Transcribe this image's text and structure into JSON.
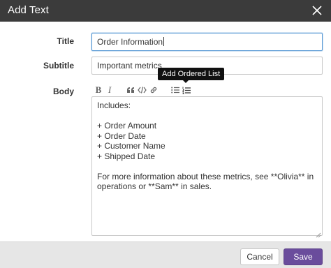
{
  "dialog": {
    "title": "Add Text"
  },
  "form": {
    "title_label": "Title",
    "title_value": "Order Information",
    "subtitle_label": "Subtitle",
    "subtitle_value": "Important metrics",
    "body_label": "Body",
    "body_value": "Includes:\n\n+ Order Amount\n+ Order Date\n+ Customer Name\n+ Shipped Date\n\nFor more information about these metrics, see **Olivia** in operations or **Sam** in sales."
  },
  "toolbar": {
    "tools": [
      "bold-icon",
      "italic-icon",
      "quote-icon",
      "code-icon",
      "link-icon",
      "unordered-list-icon",
      "ordered-list-icon"
    ],
    "bold_glyph": "B",
    "italic_glyph": "I",
    "tooltip": "Add Ordered List"
  },
  "footer": {
    "cancel_label": "Cancel",
    "save_label": "Save"
  },
  "colors": {
    "titlebar": "#3b3b3b",
    "primary": "#6a4c9c",
    "footer": "#e6e6e6"
  }
}
